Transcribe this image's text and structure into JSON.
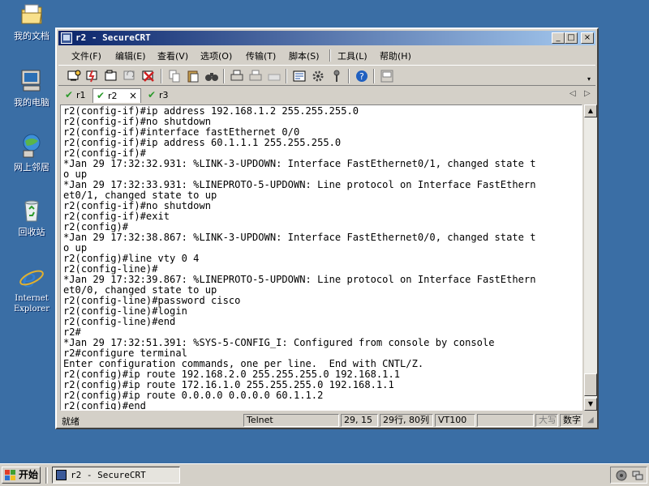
{
  "desktop": {
    "icons": [
      {
        "label": "我的文档",
        "icon": "my-documents-icon"
      },
      {
        "label": "我的电脑",
        "icon": "my-computer-icon"
      },
      {
        "label": "网上邻居",
        "icon": "network-places-icon"
      },
      {
        "label": "回收站",
        "icon": "recycle-bin-icon"
      },
      {
        "label1": "Internet",
        "label2": "Explorer",
        "icon": "internet-explorer-icon"
      }
    ]
  },
  "window": {
    "title": "r2 - SecureCRT",
    "controls": {
      "minimize": "_",
      "maximize": "□",
      "close": "×"
    }
  },
  "menu": {
    "items": [
      "文件(F)",
      "编辑(E)",
      "查看(V)",
      "选项(O)",
      "传输(T)",
      "脚本(S)",
      "工具(L)",
      "帮助(H)"
    ]
  },
  "tabs": {
    "items": [
      {
        "label": "r1",
        "check": "✔"
      },
      {
        "label": "r2",
        "check": "✔",
        "close": "×"
      },
      {
        "label": "r3",
        "check": "✔"
      }
    ],
    "prev_arrow": "◁",
    "next_arrow": "▷"
  },
  "terminal": {
    "lines": [
      "r2(config-if)#ip address 192.168.1.2 255.255.255.0",
      "r2(config-if)#no shutdown",
      "r2(config-if)#interface fastEthernet 0/0",
      "r2(config-if)#ip address 60.1.1.1 255.255.255.0",
      "r2(config-if)#",
      "*Jan 29 17:32:32.931: %LINK-3-UPDOWN: Interface FastEthernet0/1, changed state t",
      "o up",
      "*Jan 29 17:32:33.931: %LINEPROTO-5-UPDOWN: Line protocol on Interface FastEthern",
      "et0/1, changed state to up",
      "r2(config-if)#no shutdown",
      "r2(config-if)#exit",
      "r2(config)#",
      "*Jan 29 17:32:38.867: %LINK-3-UPDOWN: Interface FastEthernet0/0, changed state t",
      "o up",
      "r2(config)#line vty 0 4",
      "r2(config-line)#",
      "*Jan 29 17:32:39.867: %LINEPROTO-5-UPDOWN: Line protocol on Interface FastEthern",
      "et0/0, changed state to up",
      "r2(config-line)#password cisco",
      "r2(config-line)#login",
      "r2(config-line)#end",
      "r2#",
      "*Jan 29 17:32:51.391: %SYS-5-CONFIG_I: Configured from console by console",
      "r2#configure terminal",
      "Enter configuration commands, one per line.  End with CNTL/Z.",
      "r2(config)#ip route 192.168.2.0 255.255.255.0 192.168.1.1",
      "r2(config)#ip route 172.16.1.0 255.255.255.0 192.168.1.1",
      "r2(config)#ip route 0.0.0.0 0.0.0.0 60.1.1.2",
      "r2(config)#end"
    ]
  },
  "status": {
    "ready": "就绪",
    "protocol": "Telnet",
    "cursor": "29, 15",
    "size": "29行, 80列",
    "emulation": "VT100",
    "caps": "大写",
    "num": "数字"
  },
  "taskbar": {
    "start_label": "开始",
    "task_label": "r2 - SecureCRT"
  }
}
